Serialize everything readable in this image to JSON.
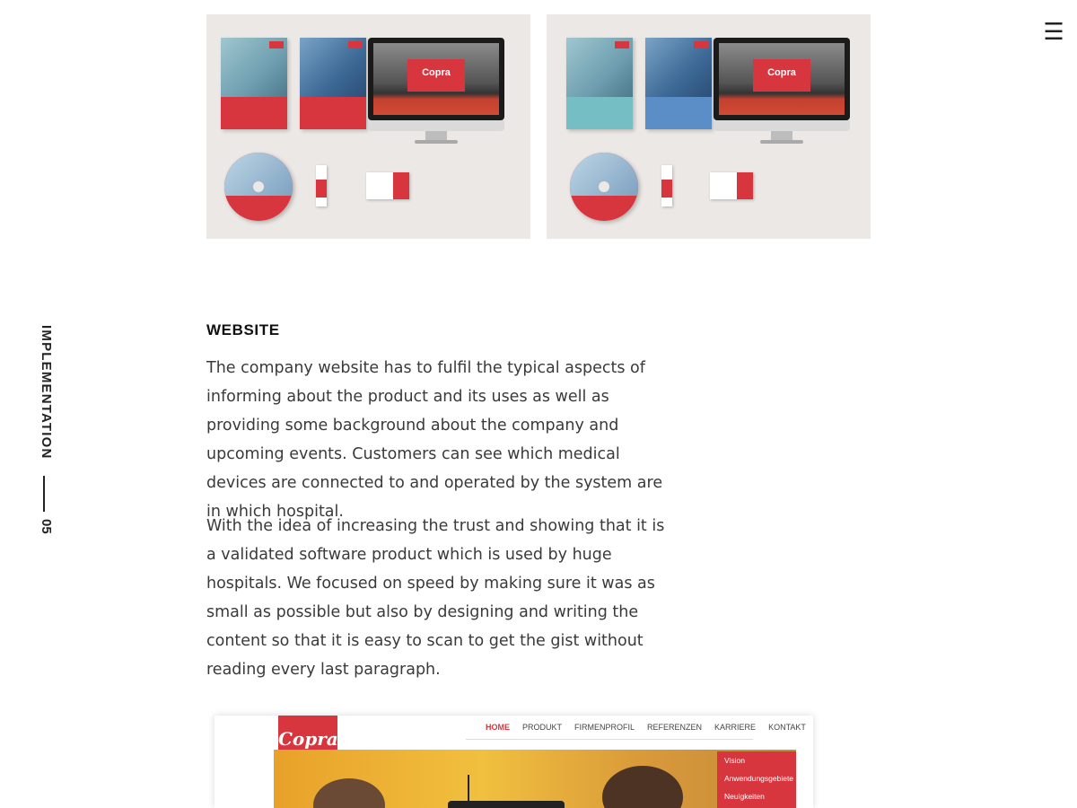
{
  "header": {
    "menu_icon": "☰"
  },
  "sidebar": {
    "section_label": "IMPLEMENTATION",
    "section_number": "05"
  },
  "gallery": {
    "logo_text": "Copra",
    "images": [
      {
        "name": "print-collateral-mockup-red"
      },
      {
        "name": "print-collateral-mockup-variant"
      }
    ]
  },
  "section": {
    "title": "WEBSITE",
    "paragraphs": [
      "The company website has to fulfil the typical aspects of informing about the product and its uses as well as providing some background about the company and upcoming events. Customers can see which medical devices are connected to and operated by the system are in which hospital.",
      "With the idea of increasing the trust and showing that it is a validated software product which is used by huge hospitals. We focused on speed by making sure it was as small as possible but also by designing and writing the content so that it is easy to scan to get the gist without reading every last paragraph."
    ]
  },
  "website_preview": {
    "logo": "Copra",
    "nav": [
      "HOME",
      "PRODUKT",
      "FIRMENPROFIL",
      "REFERENZEN",
      "KARRIERE",
      "KONTAKT"
    ],
    "side_menu": [
      "Vision",
      "Anwendungsgebiete",
      "Neuigkeiten"
    ]
  },
  "colors": {
    "accent": "#d8363f",
    "panel_bg": "#ece8e5",
    "text": "#3a3a3a"
  }
}
